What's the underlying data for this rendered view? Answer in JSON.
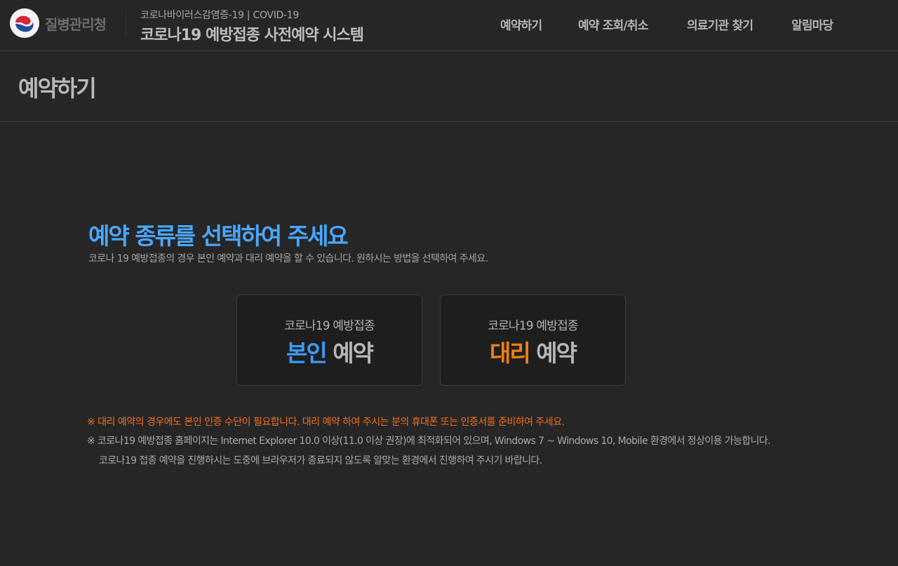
{
  "header": {
    "agency_name": "질병관리청",
    "sub_title": "코로나바이러스감염증-19 | COVID-19",
    "system_title": "코로나19 예방접종 사전예약 시스템",
    "logo_icon": "taegeuk-logo-icon",
    "nav": [
      {
        "label": "예약하기"
      },
      {
        "label": "예약 조회/취소"
      },
      {
        "label": "의료기관 찾기"
      },
      {
        "label": "알림마당"
      }
    ]
  },
  "page": {
    "title": "예약하기"
  },
  "main": {
    "heading": "예약 종류를 선택하여 주세요",
    "description": "코로나 19 예방접종의 경우 본인 예약과 대리 예약을 할 수 있습니다. 원하시는 방법을 선택하여 주세요.",
    "cards": [
      {
        "subtitle": "코로나19 예방접종",
        "accent": "본인",
        "word": "예약",
        "accent_color": "#3d9bf5"
      },
      {
        "subtitle": "코로나19 예방접종",
        "accent": "대리",
        "word": "예약",
        "accent_color": "#f07f14"
      }
    ]
  },
  "notes": {
    "warning": "※ 대리 예약의 경우에도 본인 인증 수단이 필요합니다. 대리 예약 하여 주시는 분의 휴대폰 또는 인증서를 준비하여 주세요.",
    "info": "※ 코로나19 예방접종 홈페이지는 Internet Explorer 10.0 이상(11.0 이상 권장)에 최적화되어 있으며, Windows 7 ~ Windows 10, Mobile 환경에서 정상이용 가능합니다.",
    "info2": "코로나19 접종 예약을 진행하시는 도중에 브라우저가 종료되지 않도록 알맞는 환경에서 진행하여 주시기 바랍니다."
  },
  "colors": {
    "background": "#262626",
    "heading_blue": "#4aa8ff",
    "warning_orange": "#f26d21"
  }
}
